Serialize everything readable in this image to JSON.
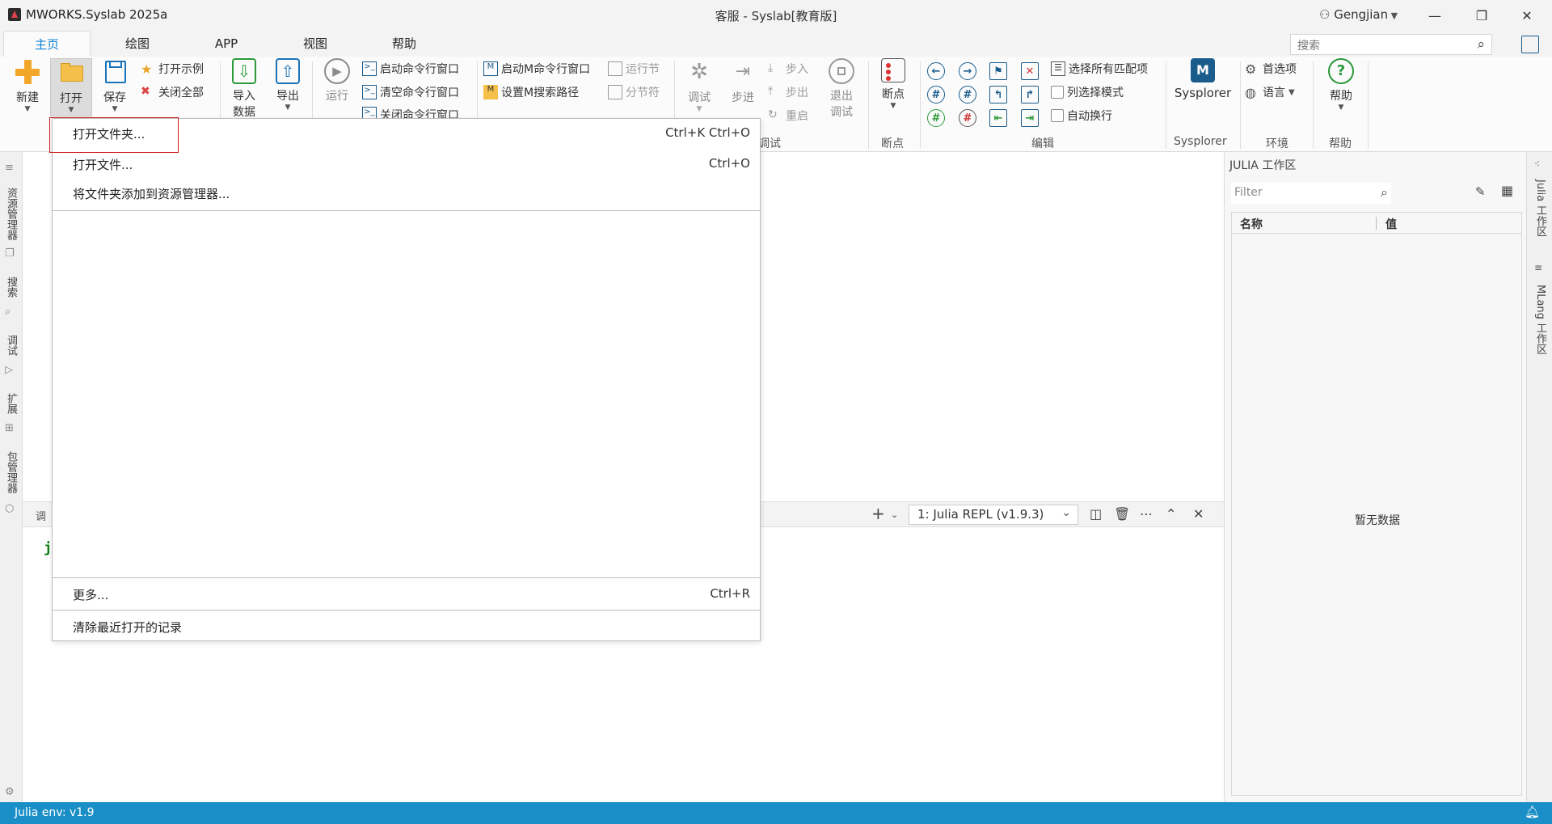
{
  "titlebar": {
    "app_name": "MWORKS.Syslab 2025a",
    "window_title": "客服 - Syslab[教育版]",
    "user": "Gengjian",
    "minimize": "—",
    "restore": "❐",
    "close": "✕"
  },
  "tabs": [
    {
      "label": "主页",
      "active": true
    },
    {
      "label": "绘图"
    },
    {
      "label": "APP"
    },
    {
      "label": "视图"
    },
    {
      "label": "帮助"
    }
  ],
  "search": {
    "placeholder": "搜索"
  },
  "ribbon": {
    "new": "新建",
    "open": "打开",
    "save": "保存",
    "open_example": "打开示例",
    "close_all": "关闭全部",
    "import_data_1": "导入",
    "import_data_2": "数据",
    "export": "导出",
    "run": "运行",
    "start_cmd": "启动命令行窗口",
    "clear_cmd": "清空命令行窗口",
    "close_cmd": "关闭命令行窗口",
    "start_m_cmd": "启动M命令行窗口",
    "set_m_path": "设置M搜索路径",
    "run_section": "运行节",
    "section_break": "分节符",
    "debug": "调试",
    "step": "步进",
    "step_in": "步入",
    "step_out": "步出",
    "restart": "重启",
    "exit_debug_1": "退出",
    "exit_debug_2": "调试",
    "breakpoint": "断点",
    "select_all_matches": "选择所有匹配项",
    "column_select": "列选择模式",
    "word_wrap": "自动换行",
    "sysplorer": "Sysplorer",
    "preferences": "首选项",
    "language": "语言",
    "help": "帮助",
    "group_debug": "调试",
    "group_breakpoint": "断点",
    "group_edit": "编辑",
    "group_sysplorer": "Sysplorer",
    "group_env": "环境",
    "group_help": "帮助"
  },
  "leftbar": {
    "explorer": "资源管理器",
    "search": "搜索",
    "debug": "调试",
    "extensions": "扩展",
    "packages": "包管理器"
  },
  "terminal": {
    "tab_partial": "调",
    "prompt": "j",
    "selected_repl": "1: Julia REPL (v1.9.3)"
  },
  "right_panel": {
    "title": "JULIA 工作区",
    "filter_placeholder": "Filter",
    "col_name": "名称",
    "col_value": "值",
    "empty": "暂无数据"
  },
  "right_strip": {
    "julia_ws": "Julia 工作区",
    "mlang_ws": "MLang 工作区"
  },
  "statusbar": {
    "env": "Julia env: v1.9"
  },
  "open_menu": {
    "items": [
      {
        "label": "打开文件夹...",
        "shortcut": "Ctrl+K Ctrl+O"
      },
      {
        "label": "打开文件...",
        "shortcut": "Ctrl+O"
      },
      {
        "label": "将文件夹添加到资源管理器...",
        "shortcut": ""
      }
    ],
    "more": {
      "label": "更多...",
      "shortcut": "Ctrl+R"
    },
    "clear_recent": {
      "label": "清除最近打开的记录"
    }
  },
  "colors": {
    "accent": "#1585d6",
    "status_bar": "#1a8fc7",
    "highlight_box": "#d11a1a",
    "prompt_green": "#0f7d11"
  }
}
